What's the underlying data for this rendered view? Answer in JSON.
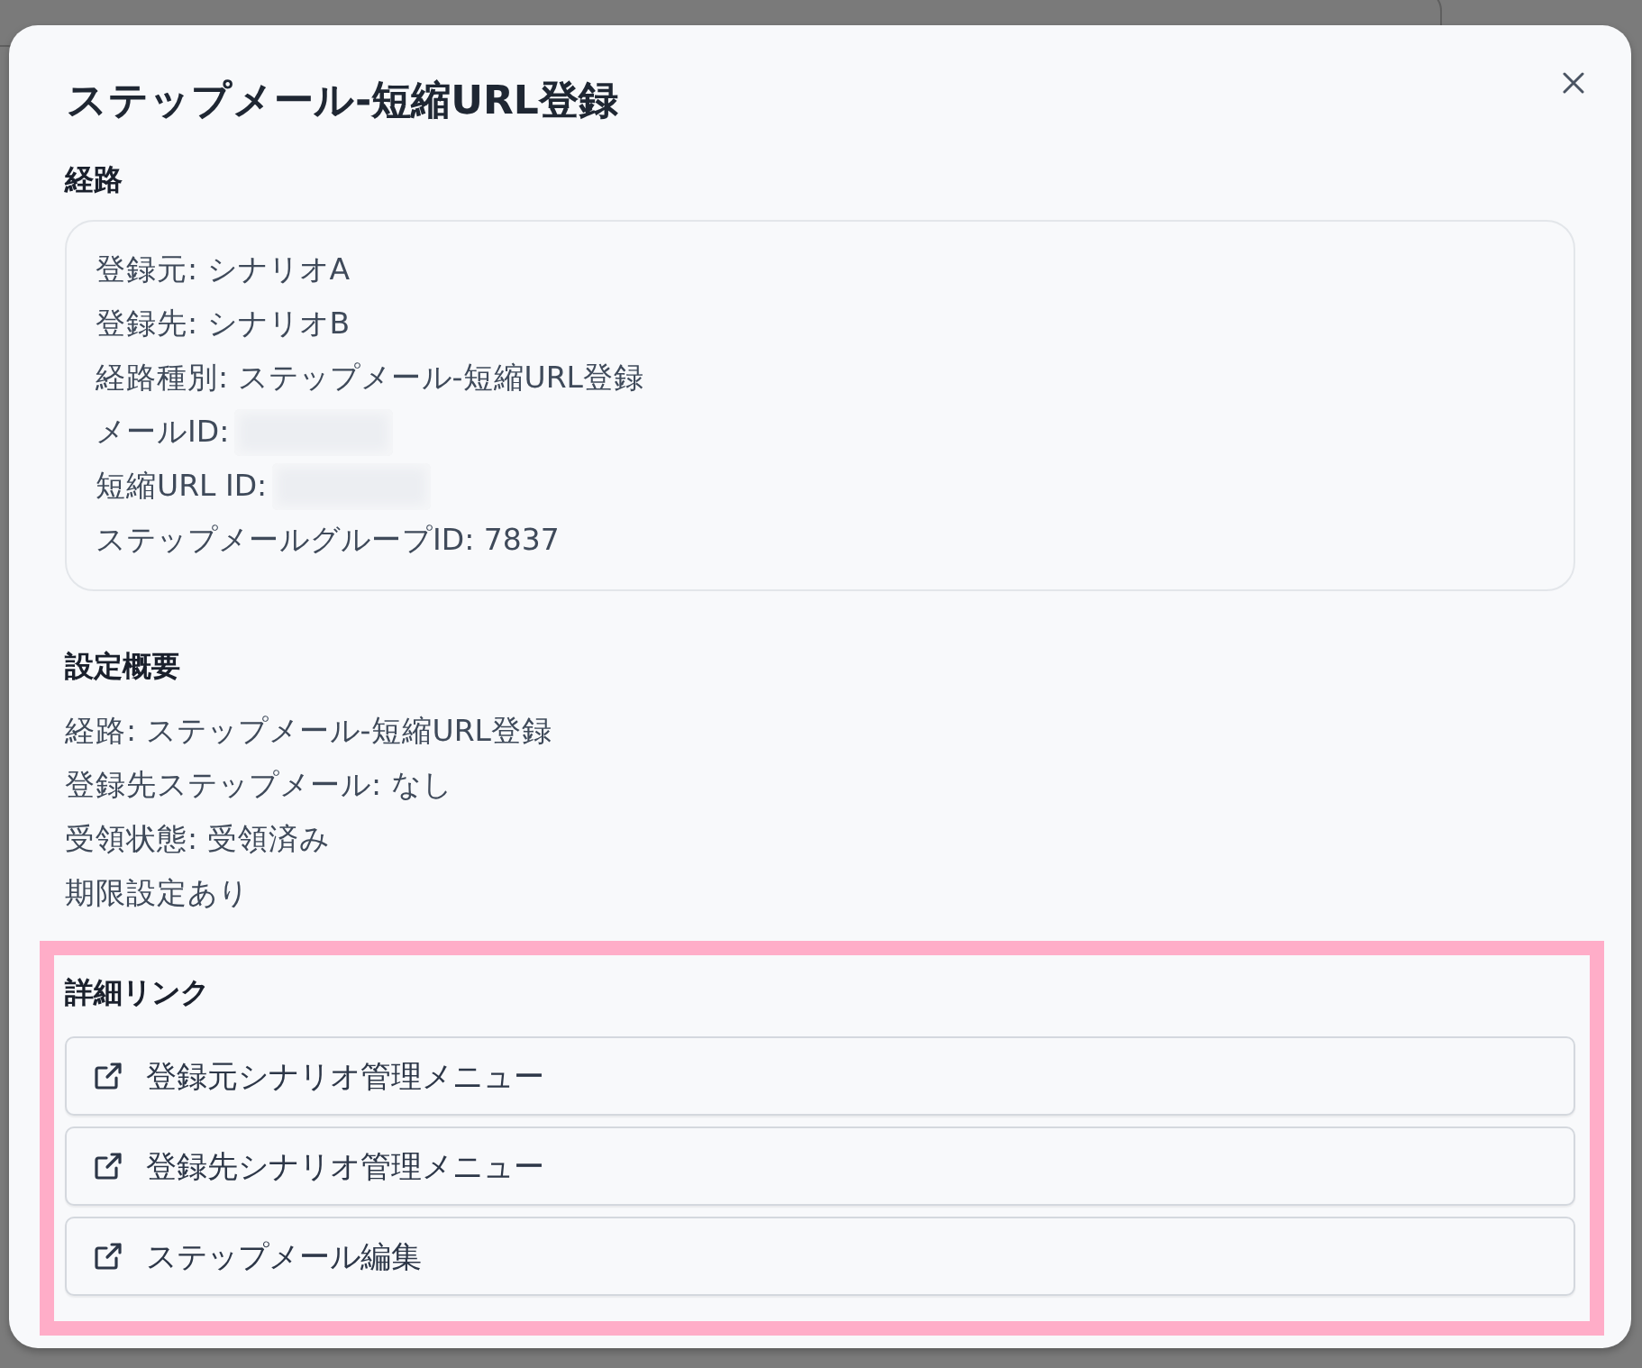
{
  "dialog": {
    "title": "ステップメール-短縮URL登録"
  },
  "route": {
    "heading": "経路",
    "items": [
      {
        "text": "登録元: シナリオA",
        "redacted": false
      },
      {
        "text": "登録先: シナリオB",
        "redacted": false
      },
      {
        "text": "経路種別: ステップメール-短縮URL登録",
        "redacted": false
      },
      {
        "text": "メールID:",
        "redacted": true
      },
      {
        "text": "短縮URL ID:",
        "redacted": true
      },
      {
        "text": "ステップメールグループID: 7837",
        "redacted": false
      }
    ]
  },
  "summary": {
    "heading": "設定概要",
    "items": [
      "経路: ステップメール-短縮URL登録",
      "登録先ステップメール: なし",
      "受領状態: 受領済み",
      "期限設定あり"
    ]
  },
  "links": {
    "heading": "詳細リンク",
    "highlighted": true,
    "items": [
      {
        "label": "登録元シナリオ管理メニュー"
      },
      {
        "label": "登録先シナリオ管理メニュー"
      },
      {
        "label": "ステップメール編集"
      }
    ]
  }
}
